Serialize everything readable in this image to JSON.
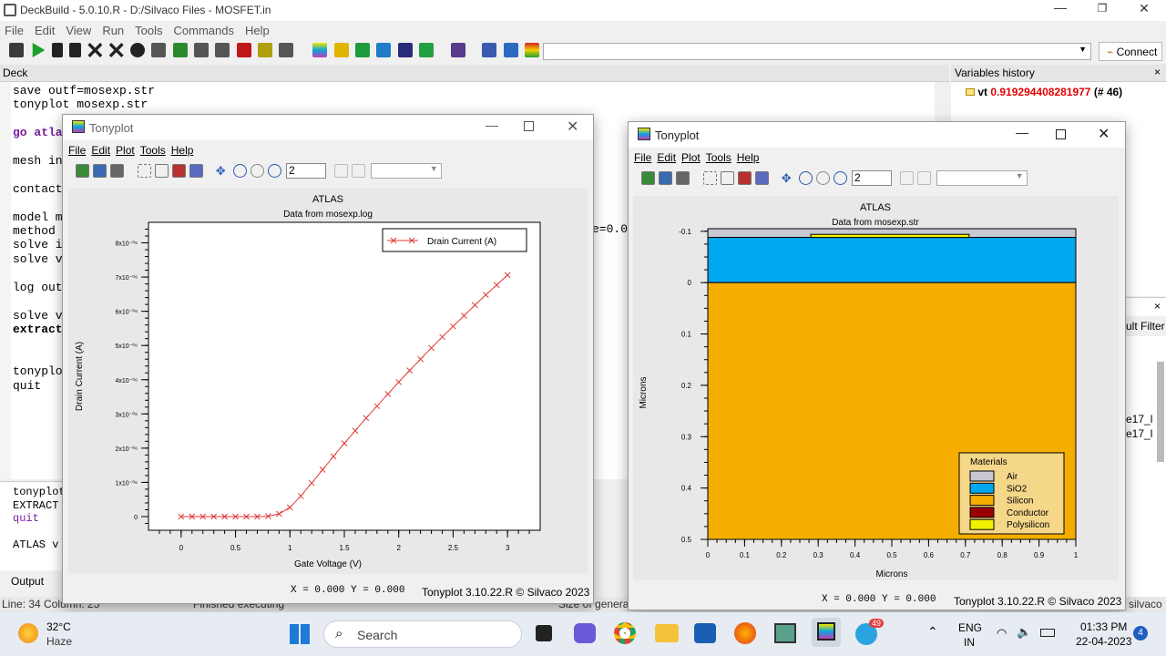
{
  "app": {
    "title": "DeckBuild - 5.0.10.R - D:/Silvaco Files - MOSFET.in",
    "menu": [
      "File",
      "Edit",
      "View",
      "Run",
      "Tools",
      "Commands",
      "Help"
    ],
    "connect_label": "Connect"
  },
  "deck": {
    "title": "Deck",
    "lines": [
      {
        "text": "save outf=mosexp.str",
        "bold": false,
        "color": "#000"
      },
      {
        "text": "tonyplot mosexp.str",
        "bold": false,
        "color": "#000"
      },
      {
        "text": "",
        "bold": false,
        "color": "#000"
      },
      {
        "text": "go atlas",
        "bold": true,
        "color": "#7a1ea1"
      },
      {
        "text": "",
        "bold": false,
        "color": "#000"
      },
      {
        "text": "mesh inf=mosexp.str",
        "bold": false,
        "color": "#000"
      },
      {
        "text": "",
        "bold": false,
        "color": "#000"
      },
      {
        "text": "contact name=gate n.poly",
        "bold": false,
        "color": "#000"
      },
      {
        "text": "",
        "bold": false,
        "color": "#000"
      },
      {
        "text": "model mos print",
        "bold": false,
        "color": "#000"
      },
      {
        "text": "method newton",
        "bold": false,
        "color": "#000"
      },
      {
        "text": "solve init",
        "bold": false,
        "color": "#000"
      },
      {
        "text": "solve vdrain=0.1",
        "bold": false,
        "color": "#000"
      },
      {
        "text": "",
        "bold": false,
        "color": "#000"
      },
      {
        "text": "log outf=mosexp.log",
        "bold": false,
        "color": "#000"
      },
      {
        "text": "",
        "bold": false,
        "color": "#000"
      },
      {
        "text": "solve vgate=0 vstep=0.1 vfinal=3.0 name=gate",
        "bold": false,
        "color": "#000"
      },
      {
        "text": "extract name=\"vt\" (xintercept(maxslope(curve(abs(v.\"gate\"),abs(i.\"drain\")))))",
        "bold": true,
        "color": "#000"
      },
      {
        "text": "",
        "bold": false,
        "color": "#000"
      },
      {
        "text": "",
        "bold": false,
        "color": "#000"
      },
      {
        "text": "tonyplot mosexp.log",
        "bold": false,
        "color": "#000"
      },
      {
        "text": "quit",
        "bold": false,
        "color": "#000"
      }
    ],
    "hidden_fragment": "e=0.0"
  },
  "variables": {
    "title": "Variables history",
    "name": "vt",
    "value": "0.919294408281977",
    "count": "(# 46)"
  },
  "right_panel": {
    "filter_label": "ult Filter",
    "item1": "e17_l",
    "item2": "e17_l"
  },
  "output": {
    "lines": [
      "tonyplot",
      "EXTRACT",
      "quit",
      "",
      "ATLAS v"
    ],
    "tab": "Output"
  },
  "statusbar": {
    "pos": "Line: 34 Column: 25",
    "state": "Finished executing",
    "size": "Size of genera",
    "right": "silvaco"
  },
  "tp1": {
    "title": "Tonyplot",
    "menu": [
      "File",
      "Edit",
      "Plot",
      "Tools",
      "Help"
    ],
    "zoom": "2",
    "readout": "X = 0.000  Y = 0.000",
    "version": "Tonyplot 3.10.22.R © Silvaco 2023"
  },
  "tp2": {
    "title": "Tonyplot",
    "menu": [
      "File",
      "Edit",
      "Plot",
      "Tools",
      "Help"
    ],
    "zoom": "2",
    "readout": "X = 0.000  Y = 0.000",
    "version": "Tonyplot 3.10.22.R © Silvaco 2023"
  },
  "chart_data": [
    {
      "type": "line",
      "title": "ATLAS",
      "subtitle": "Data from mosexp.log",
      "xlabel": "Gate Voltage (V)",
      "ylabel": "Drain Current (A)",
      "xlim": [
        -0.3,
        3.3
      ],
      "ylim": [
        -4e-07,
        8.6e-06
      ],
      "xticks": [
        "0",
        "0.5",
        "1",
        "1.5",
        "2",
        "2.5",
        "3"
      ],
      "yticks": [
        "0",
        "1x10⁻⁰⁶",
        "2x10⁻⁰⁶",
        "3x10⁻⁰⁶",
        "4x10⁻⁰⁶",
        "5x10⁻⁰⁶",
        "6x10⁻⁰⁶",
        "7x10⁻⁰⁶",
        "8x10⁻⁰⁶"
      ],
      "legend_position": "top-right",
      "series": [
        {
          "name": "Drain Current (A)",
          "color": "#e23b3b",
          "x": [
            0,
            0.1,
            0.2,
            0.3,
            0.4,
            0.5,
            0.6,
            0.7,
            0.8,
            0.9,
            1.0,
            1.1,
            1.2,
            1.3,
            1.4,
            1.5,
            1.6,
            1.7,
            1.8,
            1.9,
            2.0,
            2.1,
            2.2,
            2.3,
            2.4,
            2.5,
            2.6,
            2.7,
            2.8,
            2.9,
            3.0
          ],
          "y": [
            0,
            0,
            0,
            0,
            0,
            0,
            0,
            0,
            1e-08,
            8e-08,
            2.7e-07,
            6e-07,
            9.8e-07,
            1.37e-06,
            1.76e-06,
            2.14e-06,
            2.51e-06,
            2.88e-06,
            3.23e-06,
            3.58e-06,
            3.93e-06,
            4.27e-06,
            4.6e-06,
            4.93e-06,
            5.25e-06,
            5.56e-06,
            5.87e-06,
            6.18e-06,
            6.48e-06,
            6.77e-06,
            7.06e-06
          ]
        }
      ]
    },
    {
      "type": "area",
      "title": "ATLAS",
      "subtitle": "Data from mosexp.str",
      "xlabel": "Microns",
      "ylabel": "Microns",
      "xlim": [
        0,
        1
      ],
      "ylim": [
        -0.1,
        0.5
      ],
      "xticks": [
        "0",
        "0.1",
        "0.2",
        "0.3",
        "0.4",
        "0.5",
        "0.6",
        "0.7",
        "0.8",
        "0.9",
        "1"
      ],
      "yticks": [
        "-0.1",
        "0",
        "0.1",
        "0.2",
        "0.3",
        "0.4",
        "0.5"
      ],
      "legend_title": "Materials",
      "legend_position": "bottom-right",
      "materials": [
        {
          "name": "Air",
          "color": "#c8c8d2"
        },
        {
          "name": "SiO2",
          "color": "#00a8ef"
        },
        {
          "name": "Silicon",
          "color": "#f5ad00"
        },
        {
          "name": "Conductor",
          "color": "#9b0000"
        },
        {
          "name": "Polysilicon",
          "color": "#f2f200"
        }
      ],
      "regions": [
        {
          "material": "Air",
          "x": [
            0,
            1
          ],
          "y": [
            -0.105,
            -0.088
          ]
        },
        {
          "material": "SiO2",
          "x": [
            0,
            1
          ],
          "y": [
            -0.088,
            0
          ]
        },
        {
          "material": "Silicon",
          "x": [
            0,
            1
          ],
          "y": [
            0,
            0.5
          ]
        },
        {
          "material": "Polysilicon",
          "x": [
            0.28,
            0.71
          ],
          "y": [
            -0.094,
            -0.088
          ]
        }
      ]
    }
  ],
  "taskbar": {
    "weather_temp": "32°C",
    "weather_desc": "Haze",
    "search": "Search",
    "lang1": "ENG",
    "lang2": "IN",
    "time": "01:33 PM",
    "date": "22-04-2023",
    "notif": "4",
    "badge": "49"
  }
}
